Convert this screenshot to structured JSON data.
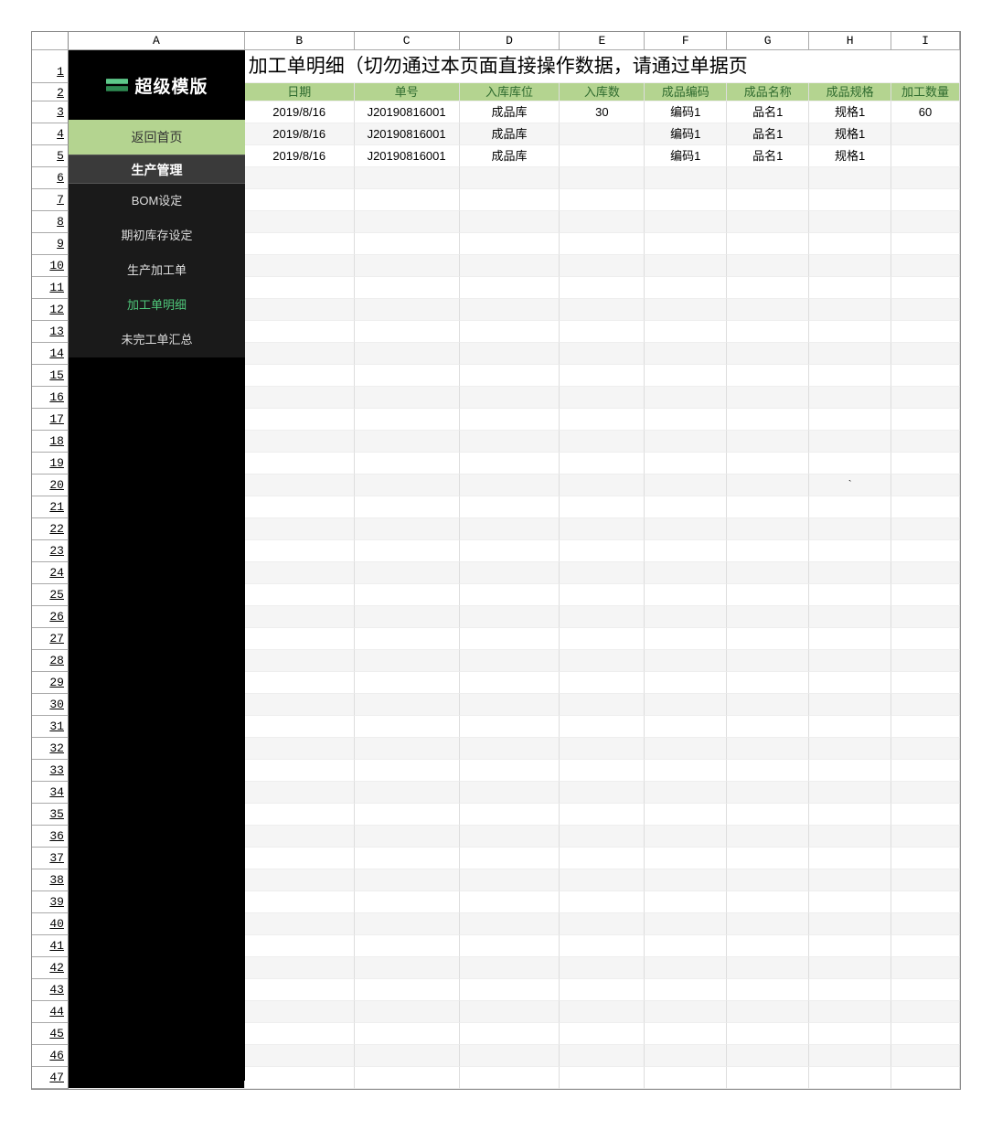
{
  "columns": [
    "A",
    "B",
    "C",
    "D",
    "E",
    "F",
    "G",
    "H",
    "I"
  ],
  "title": "加工单明细（切勿通过本页面直接操作数据，请通过单据页",
  "headers": {
    "B": "日期",
    "C": "单号",
    "D": "入库库位",
    "E": "入库数",
    "F": "成品编码",
    "G": "成品名称",
    "H": "成品规格",
    "I": "加工数量"
  },
  "rows": [
    {
      "B": "2019/8/16",
      "C": "J20190816001",
      "D": "成品库",
      "E": "30",
      "F": "编码1",
      "G": "品名1",
      "H": "规格1",
      "I": "60"
    },
    {
      "B": "2019/8/16",
      "C": "J20190816001",
      "D": "成品库",
      "E": "",
      "F": "编码1",
      "G": "品名1",
      "H": "规格1",
      "I": ""
    },
    {
      "B": "2019/8/16",
      "C": "J20190816001",
      "D": "成品库",
      "E": "",
      "F": "编码1",
      "G": "品名1",
      "H": "规格1",
      "I": ""
    }
  ],
  "stray": {
    "row": 20,
    "col": "H",
    "value": "`"
  },
  "sidebar": {
    "logo": "超级模版",
    "home": "返回首页",
    "section": "生产管理",
    "items": [
      {
        "label": "BOM设定",
        "active": false
      },
      {
        "label": "期初库存设定",
        "active": false
      },
      {
        "label": "生产加工单",
        "active": false
      },
      {
        "label": "加工单明细",
        "active": true
      },
      {
        "label": "未完工单汇总",
        "active": false
      }
    ]
  },
  "total_rows": 47
}
